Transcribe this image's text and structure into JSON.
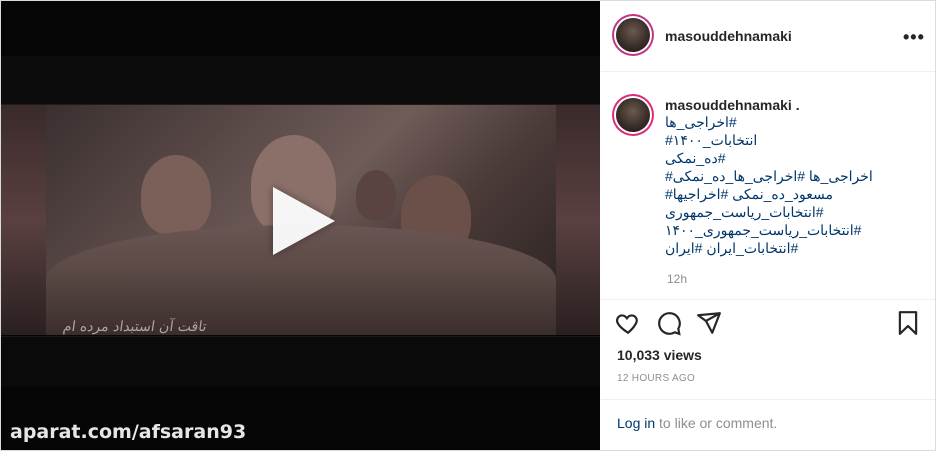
{
  "media": {
    "overlay_caption": "تاقت آن استبداد مرده ام",
    "watermark": "aparat.com/afsaran93",
    "play_icon": "play-icon"
  },
  "header": {
    "username": "masouddehnamaki",
    "more_icon": "ellipsis-icon",
    "more_label": "•••"
  },
  "caption": {
    "username": "masouddehnamaki .",
    "lines": [
      "#اخراجی_ها",
      "انتخابات_۱۴۰۰#",
      "#ده_نمکی",
      "اخراجی_ها #اخراجی_ها_ده_نمکی#",
      "مسعود_ده_نمکی #اخراجیها#",
      "#انتخابات_ریاست_جمهوری",
      "#انتخابات_ریاست_جمهوری_۱۴۰۰",
      "#انتخابات_ایران #ایران"
    ],
    "time_relative": "12h"
  },
  "actions": {
    "like_icon": "heart-icon",
    "comment_icon": "comment-icon",
    "share_icon": "paper-plane-icon",
    "save_icon": "bookmark-icon"
  },
  "stats": {
    "views": "10,033 views",
    "posted": "12 HOURS AGO"
  },
  "comment_box": {
    "login_link": "Log in",
    "rest": " to like or comment."
  },
  "colors": {
    "link": "#00376b",
    "text": "#262626",
    "muted": "#8e8e8e",
    "border": "#dbdbdb",
    "story_ring": "#c13584"
  }
}
